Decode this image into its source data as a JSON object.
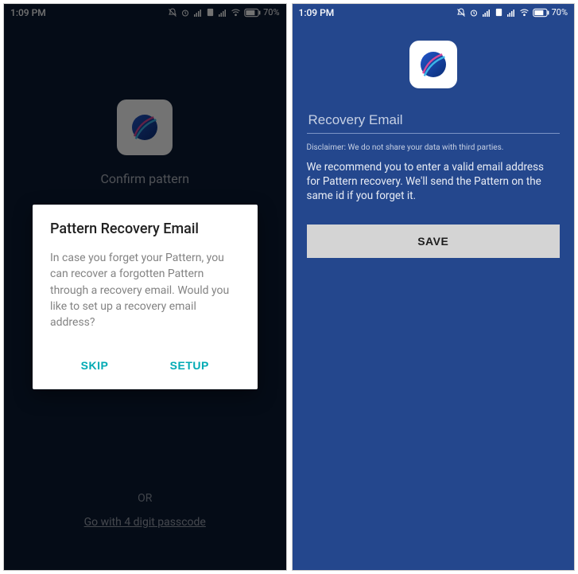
{
  "status": {
    "time": "1:09 PM",
    "battery": "70%"
  },
  "left": {
    "heading_behind": "Confirm pattern",
    "or": "OR",
    "passcode_link": "Go with 4 digit passcode",
    "dialog": {
      "title": "Pattern Recovery Email",
      "body": "In case you forget your Pattern, you can recover a forgotten Pattern through a recovery email. Would you like to set up a recovery email address?",
      "skip": "SKIP",
      "setup": "SETUP"
    }
  },
  "right": {
    "email_placeholder": "Recovery Email",
    "disclaimer": "Disclaimer: We do not share your data with third parties.",
    "recommend": "We recommend you to enter a valid email address for Pattern recovery. We'll send the Pattern on the same id if you forget it.",
    "save": "SAVE"
  }
}
